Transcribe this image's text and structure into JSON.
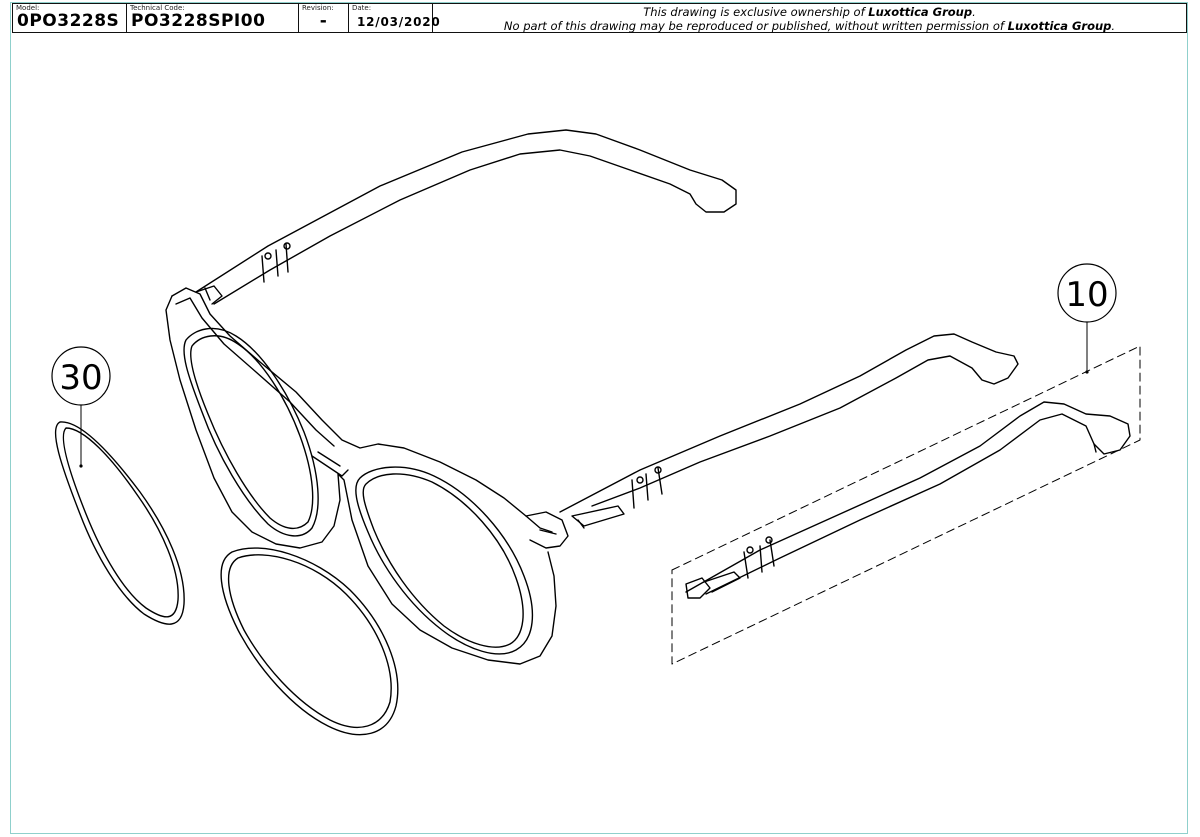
{
  "title_block": {
    "model_label": "Model:",
    "model_value": "0PO3228S",
    "technical_code_label": "Technical Code:",
    "technical_code_value": "PO3228SPI00",
    "revision_label": "Revision:",
    "revision_value": "-",
    "date_label": "Date:",
    "date_value": "12/03/2020",
    "ownership_prefix": "This drawing is exclusive ownership of ",
    "ownership_company": "Luxottica Group",
    "ownership_suffix": ".",
    "reproduction_prefix": "No part of this drawing may be reproduced or published, without written permission of ",
    "reproduction_company": "Luxottica Group",
    "reproduction_suffix": "."
  },
  "callouts": {
    "lens_part": "30",
    "temple_part": "10"
  }
}
